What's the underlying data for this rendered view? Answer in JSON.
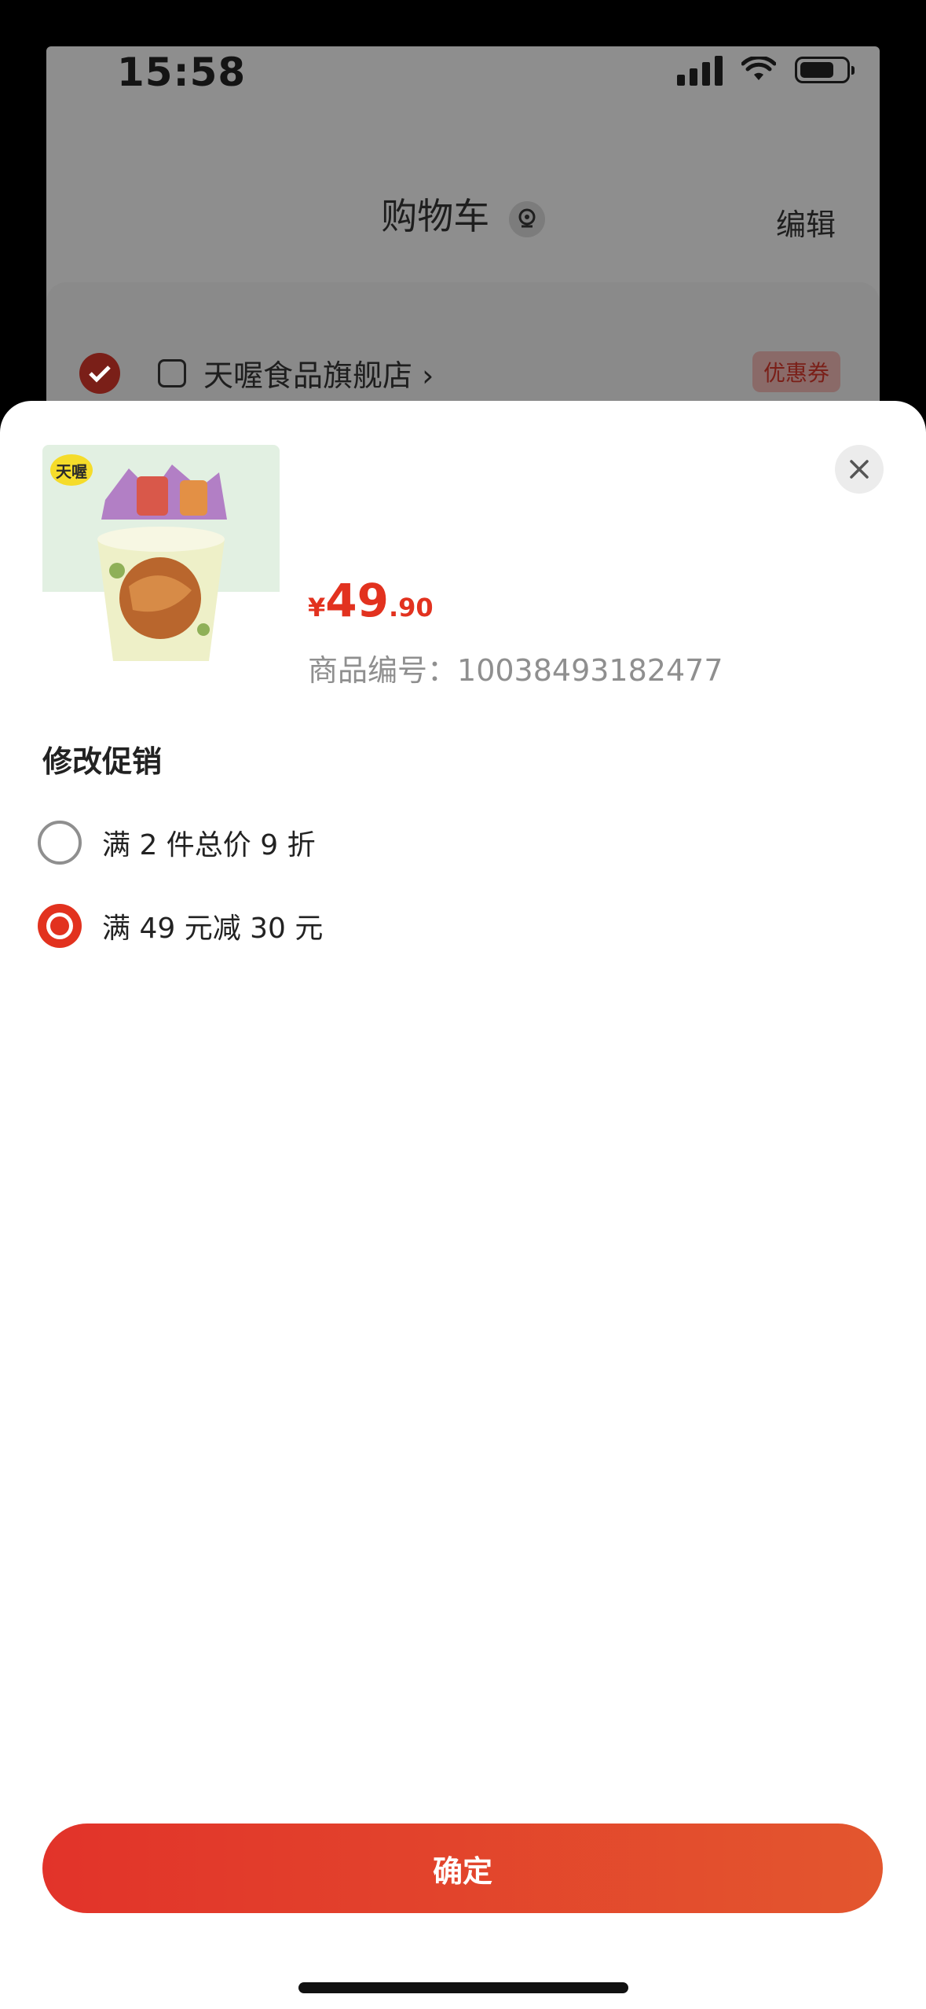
{
  "status_bar": {
    "time": "15:58"
  },
  "header": {
    "title": "购物车",
    "edit_label": "编辑"
  },
  "store": {
    "name": "天喔食品旗舰店",
    "chevron": "›",
    "coupon_label": "优惠券"
  },
  "product": {
    "logo_text": "天喔",
    "price": {
      "symbol": "¥",
      "integer": "49",
      "decimal": ".90"
    },
    "sku_label": "商品编号：",
    "sku_value": "10038493182477"
  },
  "promotion": {
    "section_title": "修改促销",
    "options": [
      {
        "label": "满 2 件总价 9 折",
        "selected": false
      },
      {
        "label": "满 49 元减 30 元",
        "selected": true
      }
    ]
  },
  "actions": {
    "confirm_label": "确定"
  },
  "colors": {
    "accent": "#e2321f",
    "overlay": "#8e8e8e",
    "sheet": "#ffffff"
  }
}
